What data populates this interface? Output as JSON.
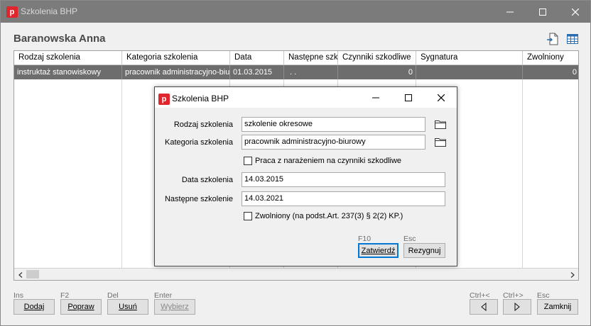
{
  "window": {
    "title": "Szkolenia BHP",
    "app_icon_letter": "p",
    "person_name": "Baranowska Anna"
  },
  "grid": {
    "columns": [
      "Rodzaj szkolenia",
      "Kategoria szkolenia",
      "Data",
      "Następne szkolenie",
      "Czynniki szkodliwe",
      "Sygnatura",
      "Zwolniony"
    ],
    "rows": [
      {
        "rodzaj": "instruktaż stanowiskowy",
        "kategoria": "pracownik administracyjno-biurowy",
        "data": "01.03.2015",
        "nastepne": ". .",
        "czynniki": "0",
        "sygnatura": "",
        "zwolniony": "0"
      }
    ]
  },
  "toolbar": {
    "add": {
      "key": "Ins",
      "label": "Dodaj"
    },
    "edit": {
      "key": "F2",
      "label": "Popraw"
    },
    "delete": {
      "key": "Del",
      "label": "Usuń"
    },
    "select": {
      "key": "Enter",
      "label": "Wybierz"
    },
    "prev": {
      "key": "Ctrl+<"
    },
    "next": {
      "key": "Ctrl+>"
    },
    "close": {
      "key": "Esc",
      "label": "Zamknij"
    }
  },
  "dialog": {
    "title": "Szkolenia BHP",
    "app_icon_letter": "p",
    "fields": {
      "rodzaj_label": "Rodzaj szkolenia",
      "rodzaj_value": "szkolenie okresowe",
      "kategoria_label": "Kategoria szkolenia",
      "kategoria_value": "pracownik administracyjno-biurowy",
      "narazenie_label": "Praca z narażeniem na czynniki szkodliwe",
      "narazenie_checked": false,
      "data_label": "Data szkolenia",
      "data_value": "14.03.2015",
      "nastepne_label": "Następne szkolenie",
      "nastepne_value": "14.03.2021",
      "zwolniony_label": "Zwolniony (na podst.Art. 237(3) § 2(2) KP.)",
      "zwolniony_checked": false
    },
    "confirm": {
      "key": "F10",
      "label": "Zatwierdź"
    },
    "cancel": {
      "key": "Esc",
      "label": "Rezygnuj"
    }
  },
  "colors": {
    "main_titlebar": "#7b7b7b",
    "selected_row": "#6d6d6d",
    "app_icon": "#e0262c"
  }
}
